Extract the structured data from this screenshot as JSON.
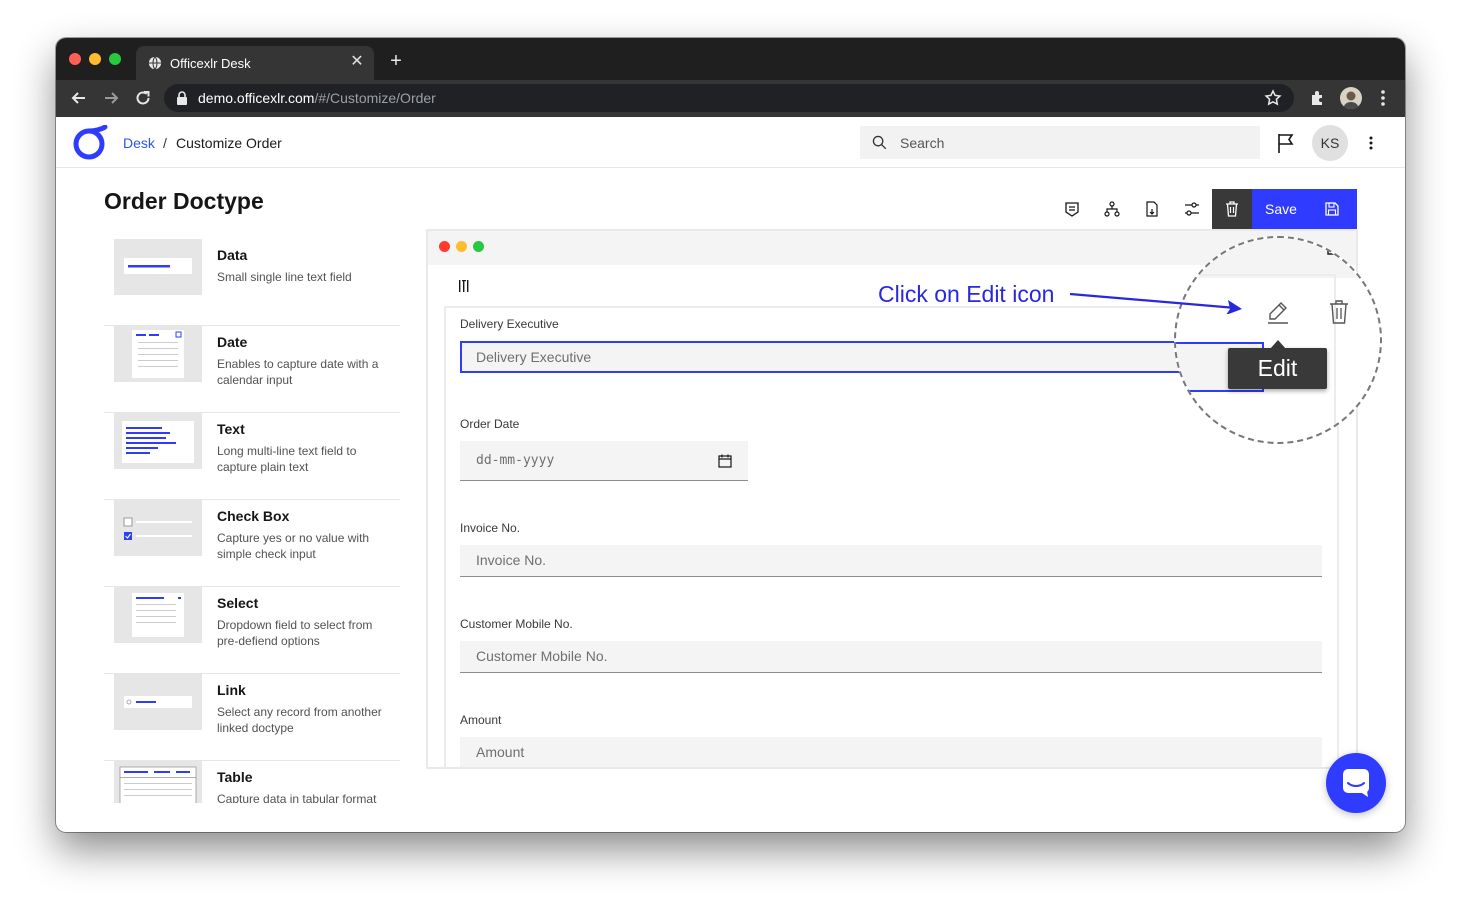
{
  "browser": {
    "tab_title": "Officexlr Desk",
    "url_host": "demo.officexlr.com",
    "url_path": "/#/Customize/Order"
  },
  "header": {
    "breadcrumb_root": "Desk",
    "breadcrumb_sep": "/",
    "breadcrumb_current": "Customize Order",
    "search_placeholder": "Search",
    "avatar_initials": "KS"
  },
  "sidebar": {
    "title": "Order Doctype",
    "components": [
      {
        "name": "Data",
        "desc": "Small single line text field"
      },
      {
        "name": "Date",
        "desc": "Enables to capture date with a calendar input"
      },
      {
        "name": "Text",
        "desc": "Long multi-line text field to capture plain text"
      },
      {
        "name": "Check Box",
        "desc": "Capture yes or no value with simple check input"
      },
      {
        "name": "Select",
        "desc": "Dropdown field to select from pre-defiend options"
      },
      {
        "name": "Link",
        "desc": "Select any record from another linked doctype"
      },
      {
        "name": "Table",
        "desc": "Capture data in tabular format"
      }
    ]
  },
  "toolbar": {
    "save_label": "Save"
  },
  "form": {
    "fields": [
      {
        "label": "Delivery Executive",
        "placeholder": "Delivery Executive"
      },
      {
        "label": "Order Date",
        "placeholder": "dd-mm-yyyy"
      },
      {
        "label": "Invoice No.",
        "placeholder": "Invoice No."
      },
      {
        "label": "Customer Mobile No.",
        "placeholder": "Customer Mobile No."
      },
      {
        "label": "Amount",
        "placeholder": "Amount"
      }
    ]
  },
  "annotation": {
    "callout": "Click on Edit icon",
    "tooltip": "Edit"
  },
  "colors": {
    "accent": "#2f3bff",
    "dark": "#393939",
    "annotation": "#2a27e0"
  }
}
